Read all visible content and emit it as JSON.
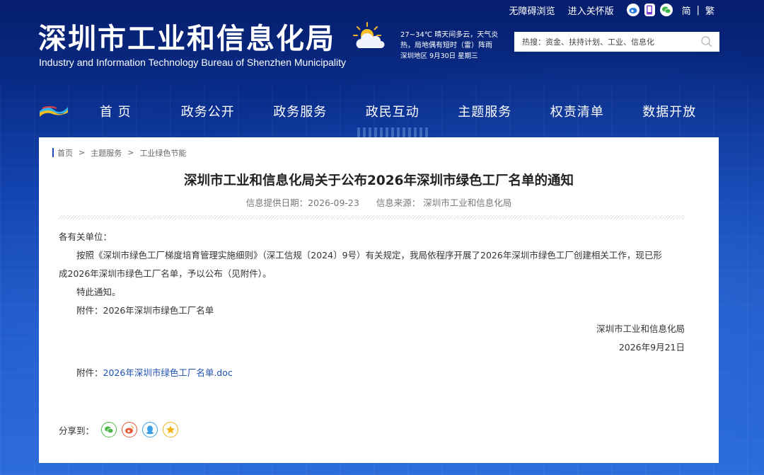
{
  "header": {
    "site_title": "深圳市工业和信息化局",
    "site_subtitle": "Industry and Information Technology Bureau of Shenzhen Municipality",
    "weather": {
      "line1": "27~34℃ 晴天间多云，天气炎",
      "line2": "热，局地偶有短时（雷）阵雨",
      "line3": "深圳地区 9月30日 星期三"
    },
    "top_links": {
      "accessibility": "无障碍浏览",
      "elder_mode": "进入关怀版",
      "simplified": "简",
      "separator": "|",
      "traditional": "繁"
    },
    "search": {
      "placeholder": "热搜：资金、扶持计划、工业、信息化"
    }
  },
  "nav": {
    "items": [
      {
        "label": "首 页"
      },
      {
        "label": "政务公开"
      },
      {
        "label": "政务服务"
      },
      {
        "label": "政民互动"
      },
      {
        "label": "主题服务"
      },
      {
        "label": "权责清单"
      },
      {
        "label": "数据开放"
      }
    ]
  },
  "breadcrumb": {
    "items": [
      "首页",
      "主题服务",
      "工业绿色节能"
    ],
    "separator": ">"
  },
  "article": {
    "title": "深圳市工业和信息化局关于公布2026年深圳市绿色工厂名单的通知",
    "date_label": "信息提供日期：2026-09-23",
    "source_label": "信息来源：",
    "source": "深圳市工业和信息化局",
    "salutation": "各有关单位：",
    "paragraph1": "按照《深圳市绿色工厂梯度培育管理实施细则》（深工信规〔2024〕9号）有关规定，我局依程序开展了2026年深圳市绿色工厂创建相关工作，现已形",
    "paragraph1b": "成2026年深圳市绿色工厂名单，予以公布（见附件）。",
    "notice": "特此通知。",
    "attachment_note": "附件：2026年深圳市绿色工厂名单",
    "signature": "深圳市工业和信息化局",
    "sign_date": "2026年9月21日",
    "attachment_label": "附件：",
    "attachment_link": "2026年深圳市绿色工厂名单.doc"
  },
  "share": {
    "label": "分享到：",
    "buttons": [
      {
        "icon": "wechat-icon",
        "color": "#4cb848"
      },
      {
        "icon": "weibo-icon",
        "color": "#e8593a"
      },
      {
        "icon": "qq-icon",
        "color": "#3b9ee8"
      },
      {
        "icon": "qzone-icon",
        "color": "#f2b21c"
      }
    ]
  },
  "colors": {
    "header_bg": "#0a2a86",
    "link": "#1e4fb0"
  }
}
